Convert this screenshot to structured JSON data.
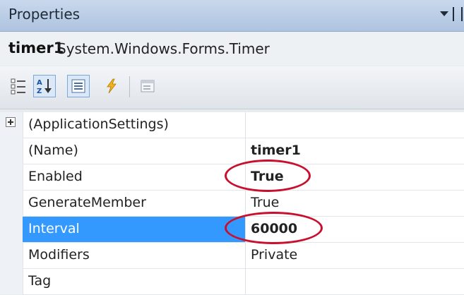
{
  "panel": {
    "title": "Properties"
  },
  "object": {
    "name": "timer1",
    "type": "System.Windows.Forms.Timer"
  },
  "toolbar": {
    "buttons": [
      "categorized-icon",
      "alphabetical-icon",
      "properties-icon",
      "events-icon",
      "property-pages-icon"
    ]
  },
  "properties": [
    {
      "name": "(ApplicationSettings)",
      "value": ""
    },
    {
      "name": "(Name)",
      "value": "timer1"
    },
    {
      "name": "Enabled",
      "value": "True"
    },
    {
      "name": "GenerateMember",
      "value": "True"
    },
    {
      "name": "Interval",
      "value": "60000"
    },
    {
      "name": "Modifiers",
      "value": "Private"
    },
    {
      "name": "Tag",
      "value": ""
    }
  ],
  "colors": {
    "selection": "#3399ff",
    "annotation": "#c8102e",
    "title_bar": "#bdd0e9"
  }
}
